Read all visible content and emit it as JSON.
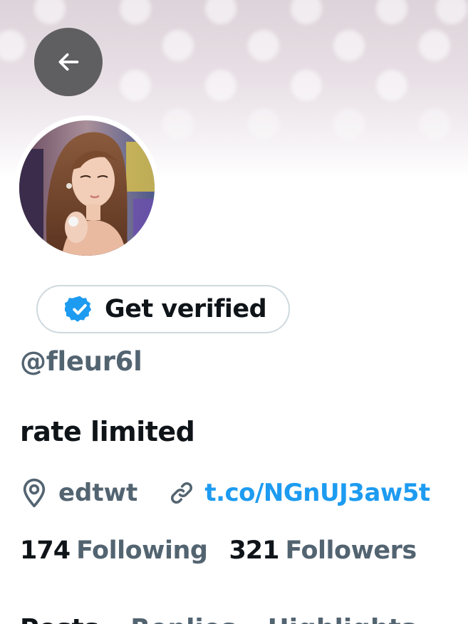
{
  "header": {
    "back_icon": "arrow-left-icon"
  },
  "profile": {
    "avatar_icon": "profile-photo",
    "verify_button": {
      "label": "Get verified",
      "icon": "verified-badge-icon",
      "badge_color": "#1d9bf0"
    },
    "handle": "@fleur6l",
    "bio": "rate limited",
    "location": {
      "icon": "location-pin-icon",
      "text": "edtwt"
    },
    "website": {
      "icon": "link-icon",
      "text": "t.co/NGnUJ3aw5t"
    },
    "stats": {
      "following_count": "174",
      "following_label": "Following",
      "followers_count": "321",
      "followers_label": "Followers"
    }
  },
  "tabs": [
    {
      "label": "Posts"
    },
    {
      "label": "Replies"
    },
    {
      "label": "Highlights"
    }
  ],
  "colors": {
    "accent": "#1d9bf0",
    "primary_text": "#0f1419",
    "secondary_text": "#536471"
  }
}
